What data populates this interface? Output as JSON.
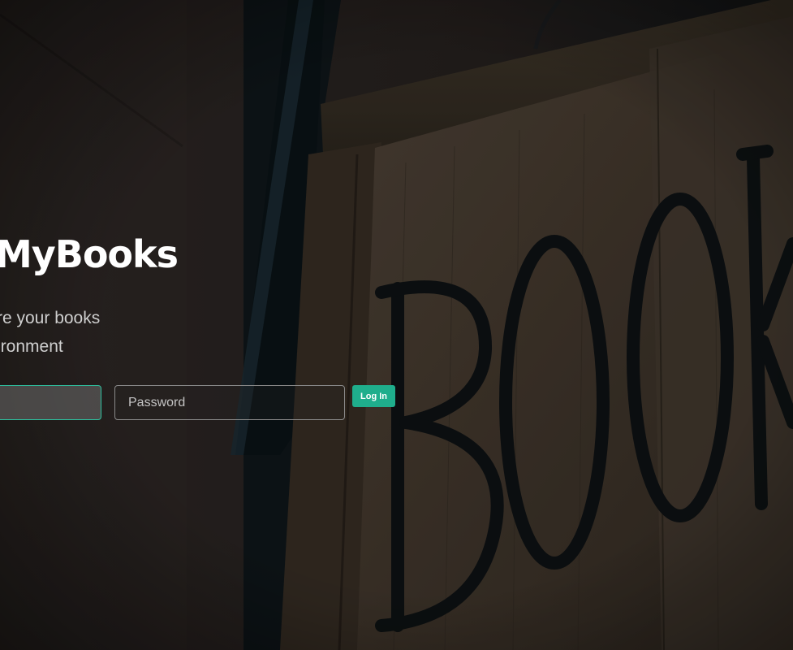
{
  "app": {
    "title": "MyBooks",
    "subtitle_lines": [
      "re your books",
      "ironment"
    ]
  },
  "login_form": {
    "email_value": "",
    "password_placeholder": "Password",
    "login_label": "Log In"
  },
  "background": {
    "painted_sign_text": "BOOK"
  },
  "colors": {
    "accent": "#1fae8c",
    "focus_border": "#2ebf9e",
    "title": "#ffffff"
  }
}
